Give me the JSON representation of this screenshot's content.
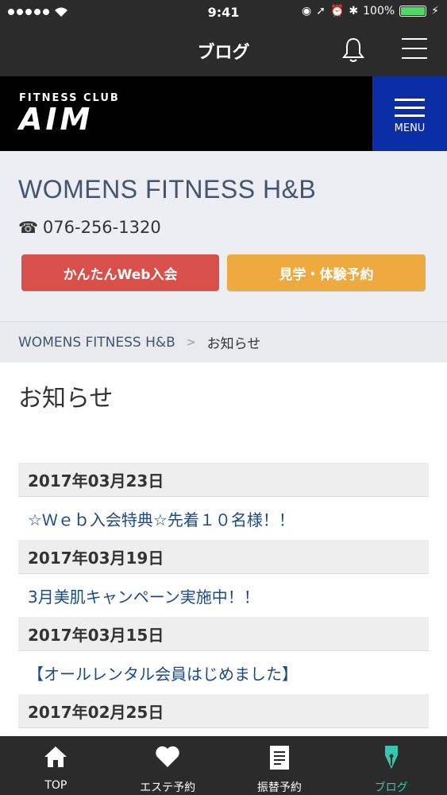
{
  "status_bar": {
    "time": "9:41",
    "battery": "100%"
  },
  "nav": {
    "title": "ブログ"
  },
  "brand": {
    "logo_small": "FITNESS CLUB",
    "logo_big": "AIM",
    "menu_label": "MENU",
    "menu_color": "#0b2ea6"
  },
  "club": {
    "name": "WOMENS FITNESS H&B",
    "phone": "076-256-1320",
    "join_button": "かんたんWeb入会",
    "trial_button": "見学・体験予約"
  },
  "breadcrumb": {
    "home": "WOMENS FITNESS H&B",
    "separator": ">",
    "current": "お知らせ"
  },
  "page": {
    "title": "お知らせ"
  },
  "posts": [
    {
      "date": "2017年03月23日",
      "title": "☆Ｗｅｂ入会特典☆先着１０名様！！"
    },
    {
      "date": "2017年03月19日",
      "title": "3月美肌キャンペーン実施中！！"
    },
    {
      "date": "2017年03月15日",
      "title": "【オールレンタル会員はじめました】"
    },
    {
      "date": "2017年02月25日",
      "title": ""
    }
  ],
  "tabs": [
    {
      "label": "TOP",
      "icon": "home-icon"
    },
    {
      "label": "エステ予約",
      "icon": "heart-icon"
    },
    {
      "label": "振替予約",
      "icon": "document-icon"
    },
    {
      "label": "ブログ",
      "icon": "pen-icon",
      "active": true
    }
  ],
  "colors": {
    "accent_teal": "#39c4b0",
    "join_red": "#d94f4a",
    "trial_orange": "#eea93f"
  }
}
